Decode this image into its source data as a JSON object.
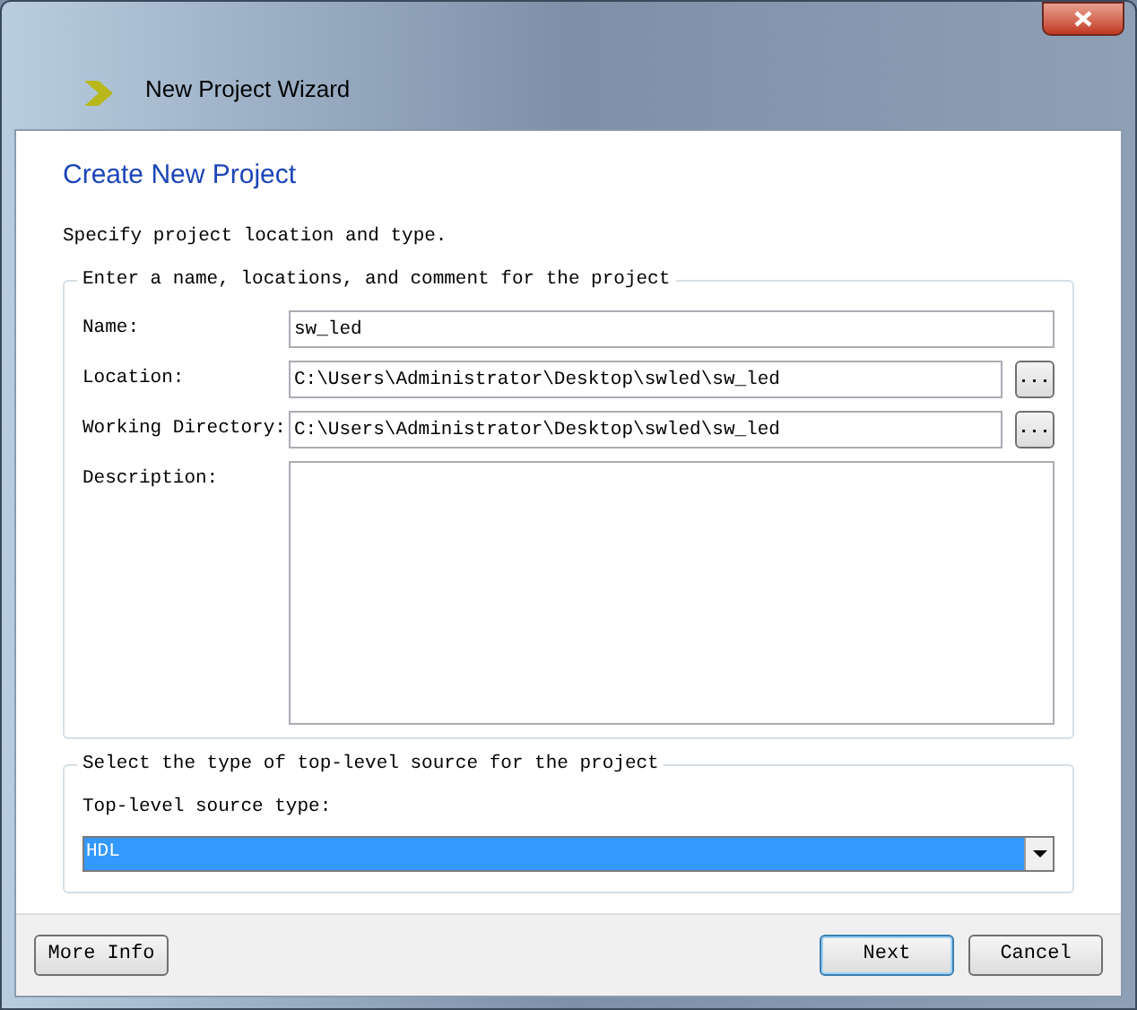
{
  "window": {
    "title": "New Project Wizard"
  },
  "page": {
    "heading": "Create New Project",
    "intro": "Specify project location and type."
  },
  "project_group": {
    "legend": "Enter a name, locations, and comment for the project",
    "fields": [
      {
        "kind": "text",
        "label": "Name:",
        "value": "sw_led"
      },
      {
        "kind": "browse",
        "label": "Location:",
        "value": "C:\\Users\\Administrator\\Desktop\\swled\\sw_led",
        "button": "..."
      },
      {
        "kind": "browse",
        "label": "Working Directory:",
        "value": "C:\\Users\\Administrator\\Desktop\\swled\\sw_led",
        "button": "..."
      },
      {
        "kind": "textarea",
        "label": "Description:"
      }
    ]
  },
  "source_group": {
    "legend": "Select the type of top-level source for the project",
    "label": "Top-level source type:",
    "value": "HDL"
  },
  "buttons": [
    {
      "label": "More Info",
      "default": false
    },
    {
      "label": "Next",
      "default": true
    },
    {
      "label": "Cancel",
      "default": false
    }
  ]
}
